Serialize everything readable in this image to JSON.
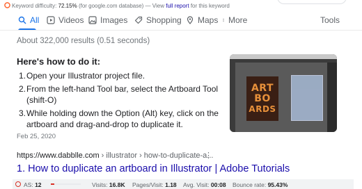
{
  "keyword_bar": {
    "label": "Keyword difficulty:",
    "value": "72.15%",
    "note": "(for google.com database) —",
    "link_prefix": "View",
    "link": "full report",
    "suffix": "for this keyword"
  },
  "tabs": [
    {
      "label": "All",
      "icon": "search-icon",
      "active": true
    },
    {
      "label": "Videos",
      "icon": "video-icon"
    },
    {
      "label": "Images",
      "icon": "image-icon"
    },
    {
      "label": "Shopping",
      "icon": "tag-icon"
    },
    {
      "label": "Maps",
      "icon": "map-pin-icon"
    },
    {
      "label": "More",
      "icon": "more-vertical-icon"
    }
  ],
  "tools_label": "Tools",
  "results_stats": "About 322,000 results (0.51 seconds)",
  "featured_snippet": {
    "heading": "Here's how to do it:",
    "steps": [
      {
        "num": "1.",
        "text": "Open your Illustrator project file."
      },
      {
        "num": "2.",
        "text": "From the left-hand Tool bar, select the Artboard Tool (shift-O)"
      },
      {
        "num": "3.",
        "text": "While holding down the Option (Alt) key, click on the artboard and drag-and-drop to duplicate it."
      }
    ],
    "date": "Feb 25, 2020",
    "thumbnail_text": [
      "ART",
      "BO",
      "ARDS"
    ]
  },
  "result": {
    "url_domain": "https://www.dabblle.com",
    "url_path": " › illustrator › how-to-duplicate-a...",
    "more_glyph": "⋮",
    "number": "1.",
    "title": "How to duplicate an artboard in Illustrator | Adobe Tutorials"
  },
  "seo_bar": {
    "as_label": "AS:",
    "as_value": "12",
    "as_fraction": 0.12,
    "visits_label": "Visits:",
    "visits_value": "16.8K",
    "pages_label": "Pages/Visit:",
    "pages_value": "1.18",
    "time_label": "Avg. Visit:",
    "time_value": "00:08",
    "bounce_label": "Bounce rate:",
    "bounce_value": "95.43%"
  },
  "colors": {
    "link": "#1a0dab",
    "accent": "#1a73e8",
    "as_red": "#d93025"
  }
}
